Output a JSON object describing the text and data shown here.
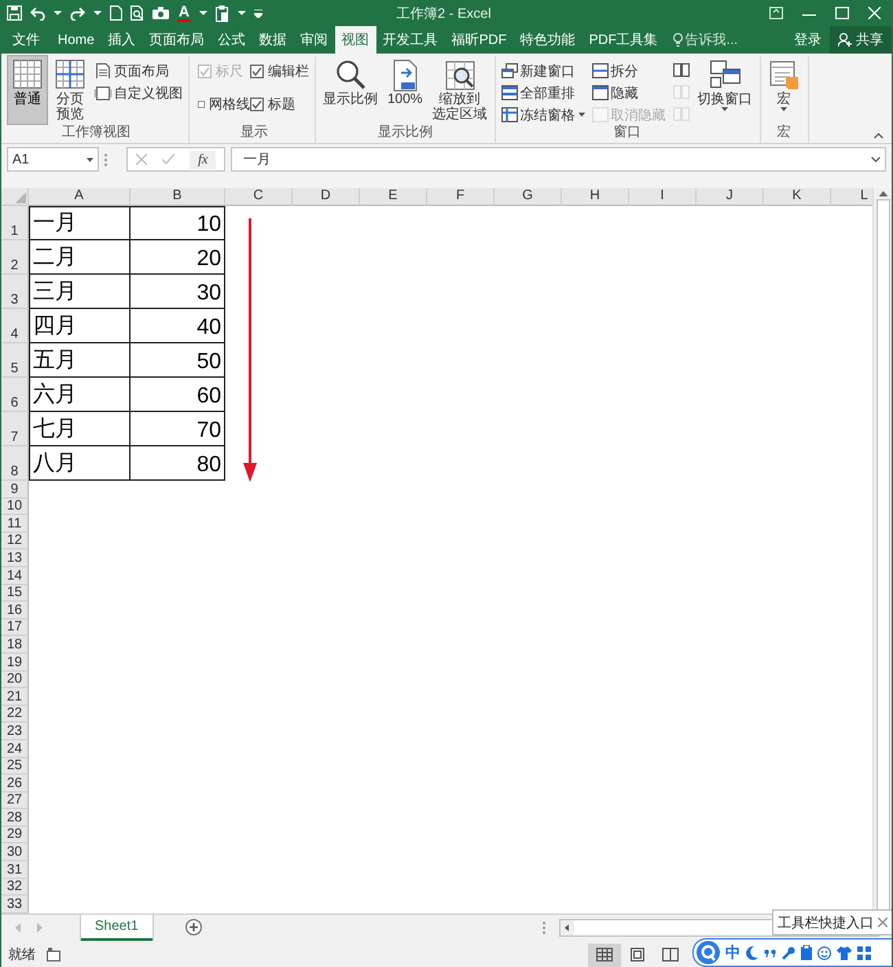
{
  "window": {
    "title": "工作簿2 - Excel"
  },
  "quick_access": {
    "font_color_letter": "A"
  },
  "tabs": [
    {
      "label": "文件",
      "selected": false
    },
    {
      "label": "Home",
      "selected": false
    },
    {
      "label": "插入",
      "selected": false
    },
    {
      "label": "页面布局",
      "selected": false
    },
    {
      "label": "公式",
      "selected": false
    },
    {
      "label": "数据",
      "selected": false
    },
    {
      "label": "审阅",
      "selected": false
    },
    {
      "label": "视图",
      "selected": true
    },
    {
      "label": "开发工具",
      "selected": false
    },
    {
      "label": "福昕PDF",
      "selected": false
    },
    {
      "label": "特色功能",
      "selected": false
    },
    {
      "label": "PDF工具集",
      "selected": false
    }
  ],
  "tell_me": {
    "placeholder": "告诉我..."
  },
  "sign_in": "登录",
  "share": "共享",
  "ribbon": {
    "groups": [
      {
        "label": "工作簿视图",
        "items": [
          {
            "kind": "large",
            "label": "普通",
            "selected": true
          },
          {
            "kind": "large",
            "lines": [
              "分页",
              "预览"
            ],
            "selected": false
          },
          {
            "kind": "small",
            "label": "页面布局",
            "selected": false
          },
          {
            "kind": "small",
            "label": "自定义视图",
            "selected": false
          }
        ]
      },
      {
        "label": "显示",
        "items": [
          {
            "kind": "checkbox",
            "label": "标尺",
            "checked": true,
            "disabled": true
          },
          {
            "kind": "checkbox",
            "label": "编辑栏",
            "checked": true,
            "disabled": false
          },
          {
            "kind": "checkbox",
            "label": "网格线",
            "checked": false,
            "disabled": false
          },
          {
            "kind": "checkbox",
            "label": "标题",
            "checked": true,
            "disabled": false
          }
        ]
      },
      {
        "label": "显示比例",
        "items": [
          {
            "kind": "large",
            "label": "显示比例"
          },
          {
            "kind": "large",
            "label": "100%"
          },
          {
            "kind": "large",
            "lines": [
              "缩放到",
              "选定区域"
            ]
          }
        ]
      },
      {
        "label": "窗口",
        "items": [
          {
            "kind": "small",
            "label": "新建窗口",
            "disabled": false
          },
          {
            "kind": "small",
            "label": "全部重排",
            "disabled": false
          },
          {
            "kind": "small",
            "label": "冻结窗格",
            "disabled": false,
            "menu": true
          },
          {
            "kind": "small",
            "label": "拆分",
            "disabled": false
          },
          {
            "kind": "small",
            "label": "隐藏",
            "disabled": false
          },
          {
            "kind": "small",
            "label": "取消隐藏",
            "disabled": true
          },
          {
            "kind": "icon",
            "disabled": false
          },
          {
            "kind": "icon",
            "disabled": true
          },
          {
            "kind": "icon",
            "disabled": true
          },
          {
            "kind": "large",
            "label": "切换窗口",
            "menu": true
          }
        ]
      },
      {
        "label": "宏",
        "items": [
          {
            "kind": "large",
            "label": "宏",
            "menu": true
          }
        ]
      }
    ]
  },
  "formula_bar": {
    "name_box": "A1",
    "function_label": "fx",
    "value": "一月"
  },
  "sheet": {
    "columns": [
      "A",
      "B",
      "C",
      "D",
      "E",
      "F",
      "G",
      "H",
      "I",
      "J",
      "K",
      "L"
    ],
    "rows": [
      {
        "number": "1",
        "cells": [
          "一月",
          "10"
        ]
      },
      {
        "number": "2",
        "cells": [
          "二月",
          "20"
        ]
      },
      {
        "number": "3",
        "cells": [
          "三月",
          "30"
        ]
      },
      {
        "number": "4",
        "cells": [
          "四月",
          "40"
        ]
      },
      {
        "number": "5",
        "cells": [
          "五月",
          "50"
        ]
      },
      {
        "number": "6",
        "cells": [
          "六月",
          "60"
        ]
      },
      {
        "number": "7",
        "cells": [
          "七月",
          "70"
        ]
      },
      {
        "number": "8",
        "cells": [
          "八月",
          "80"
        ]
      },
      {
        "number": "9"
      },
      {
        "number": "10"
      },
      {
        "number": "11"
      },
      {
        "number": "12"
      },
      {
        "number": "13"
      },
      {
        "number": "14"
      },
      {
        "number": "15"
      },
      {
        "number": "16"
      },
      {
        "number": "17"
      },
      {
        "number": "18"
      },
      {
        "number": "19"
      },
      {
        "number": "20"
      },
      {
        "number": "21"
      },
      {
        "number": "22"
      },
      {
        "number": "23"
      },
      {
        "number": "24"
      },
      {
        "number": "25"
      },
      {
        "number": "26"
      },
      {
        "number": "27"
      },
      {
        "number": "28"
      },
      {
        "number": "29"
      },
      {
        "number": "30"
      },
      {
        "number": "31"
      },
      {
        "number": "32"
      },
      {
        "number": "33"
      }
    ]
  },
  "sheet_tabs": [
    {
      "label": "Sheet1",
      "selected": true
    }
  ],
  "status_bar": {
    "text": "就绪",
    "views": [
      {
        "selected": true
      },
      {
        "selected": false
      },
      {
        "selected": false
      }
    ]
  },
  "tooltip": {
    "text": "工具栏快捷入口"
  },
  "ime_bar": {
    "mode": "中"
  }
}
